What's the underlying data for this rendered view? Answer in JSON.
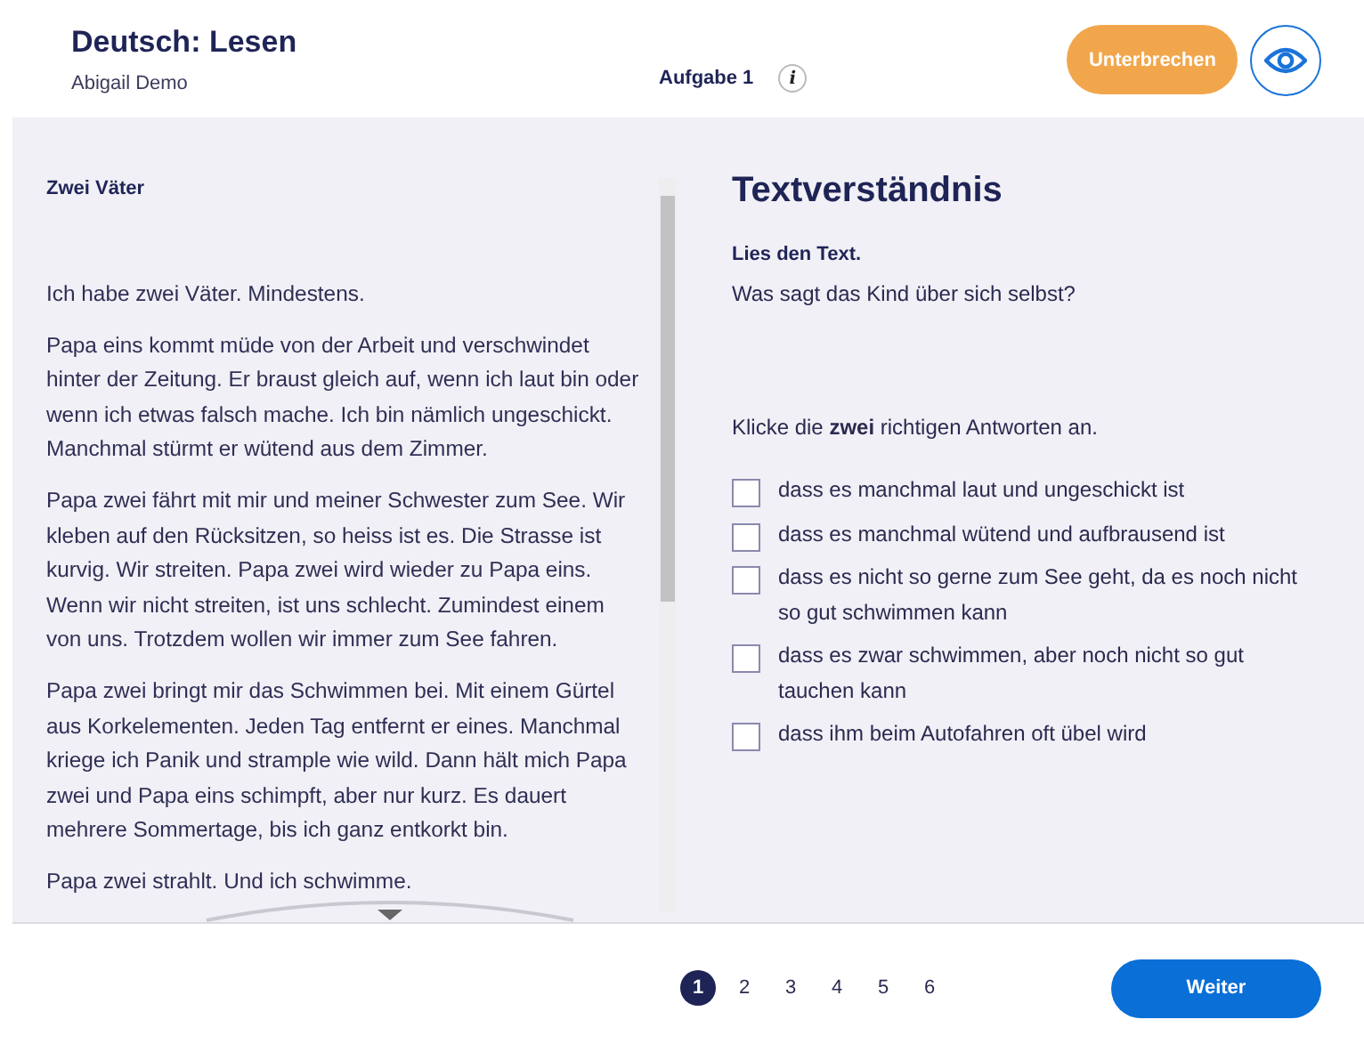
{
  "header": {
    "title": "Deutsch: Lesen",
    "user": "Abigail Demo",
    "task": "Aufgabe 1",
    "info_icon": "i",
    "pause_button": "Unterbrechen"
  },
  "text_panel": {
    "title": "Zwei Väter",
    "paragraphs": [
      "Ich habe zwei Väter. Mindestens.",
      "Papa eins kommt müde von der Arbeit und verschwindet hinter der Zeitung. Er braust gleich auf, wenn ich laut bin oder wenn ich etwas falsch mache. Ich bin nämlich ungeschickt. Manchmal stürmt er wütend aus dem Zimmer.",
      "Papa zwei fährt mit mir und meiner Schwester zum See. Wir kleben auf den Rücksitzen, so heiss ist es. Die Strasse ist kurvig. Wir streiten. Papa zwei wird wieder zu Papa eins. Wenn wir nicht streiten, ist uns schlecht. Zumindest einem von uns. Trotzdem wollen wir immer zum See fahren.",
      "Papa zwei bringt mir das Schwimmen bei. Mit einem Gürtel aus Korkelementen. Jeden Tag entfernt er eines. Manchmal kriege ich Panik und strample wie wild. Dann hält mich Papa zwei und Papa eins schimpft, aber nur kurz. Es dauert mehrere Sommertage, bis ich ganz entkorkt bin.",
      "Papa zwei strahlt. Und ich schwimme."
    ]
  },
  "question": {
    "title": "Textverständnis",
    "instruction": "Lies den Text.",
    "prompt": "Was sagt das Kind über sich selbst?",
    "hint": "Klicke die **zwei** richtigen Antworten an.",
    "options": [
      {
        "label": "dass es manchmal laut und ungeschickt ist",
        "checked": false
      },
      {
        "label": "dass es manchmal wütend und aufbrausend ist",
        "checked": false
      },
      {
        "label": "dass es nicht so gerne zum See geht, da es noch nicht so gut schwimmen kann",
        "checked": false
      },
      {
        "label": "dass es zwar schwimmen, aber noch nicht so gut tauchen kann",
        "checked": false
      },
      {
        "label": "dass ihm beim Autofahren oft übel wird",
        "checked": false
      }
    ]
  },
  "pages": [
    {
      "label": "1",
      "selected": true
    },
    {
      "label": "2",
      "selected": false
    },
    {
      "label": "3",
      "selected": false
    },
    {
      "label": "4",
      "selected": false
    },
    {
      "label": "5",
      "selected": false
    },
    {
      "label": "6",
      "selected": false
    }
  ],
  "next_button": "Weiter"
}
